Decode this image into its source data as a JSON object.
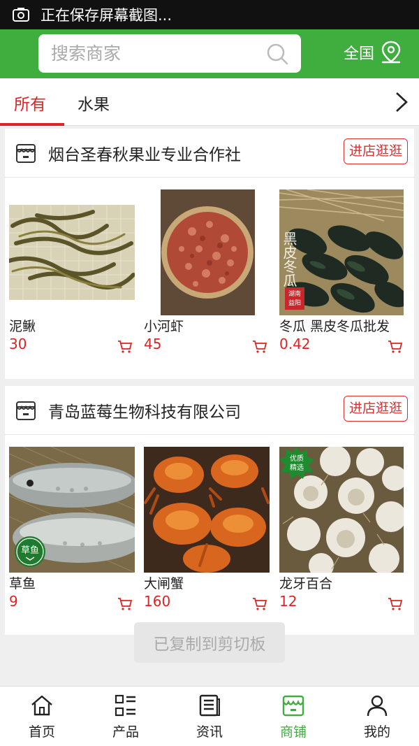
{
  "status_bar": {
    "text": "正在保存屏幕截图..."
  },
  "header": {
    "search_placeholder": "搜索商家",
    "region": "全国"
  },
  "tabs": [
    {
      "label": "所有",
      "active": true
    },
    {
      "label": "水果",
      "active": false
    }
  ],
  "shops": [
    {
      "name": "烟台圣春秋果业专业合作社",
      "enter_label": "进店逛逛",
      "products": [
        {
          "name": "泥鳅",
          "price": "30"
        },
        {
          "name": "小河虾",
          "price": "45"
        },
        {
          "name": "冬瓜 黑皮冬瓜批发",
          "price": "0.42",
          "image_text": "黑皮冬瓜",
          "image_seal": "湖南益阳"
        }
      ]
    },
    {
      "name": "青岛蓝莓生物科技有限公司",
      "enter_label": "进店逛逛",
      "products": [
        {
          "name": "草鱼",
          "price": "9",
          "badge": "草鱼"
        },
        {
          "name": "大闸蟹",
          "price": "160"
        },
        {
          "name": "龙牙百合",
          "price": "12",
          "badge": "优质精选"
        }
      ]
    }
  ],
  "toast": "已复制到剪切板",
  "bottom_nav": [
    {
      "label": "首页",
      "icon": "home-icon"
    },
    {
      "label": "产品",
      "icon": "product-list-icon"
    },
    {
      "label": "资讯",
      "icon": "news-icon"
    },
    {
      "label": "商铺",
      "icon": "shop-icon",
      "active": true
    },
    {
      "label": "我的",
      "icon": "user-icon"
    }
  ],
  "colors": {
    "brand_green": "#3fae3f",
    "accent_red": "#e02222"
  }
}
